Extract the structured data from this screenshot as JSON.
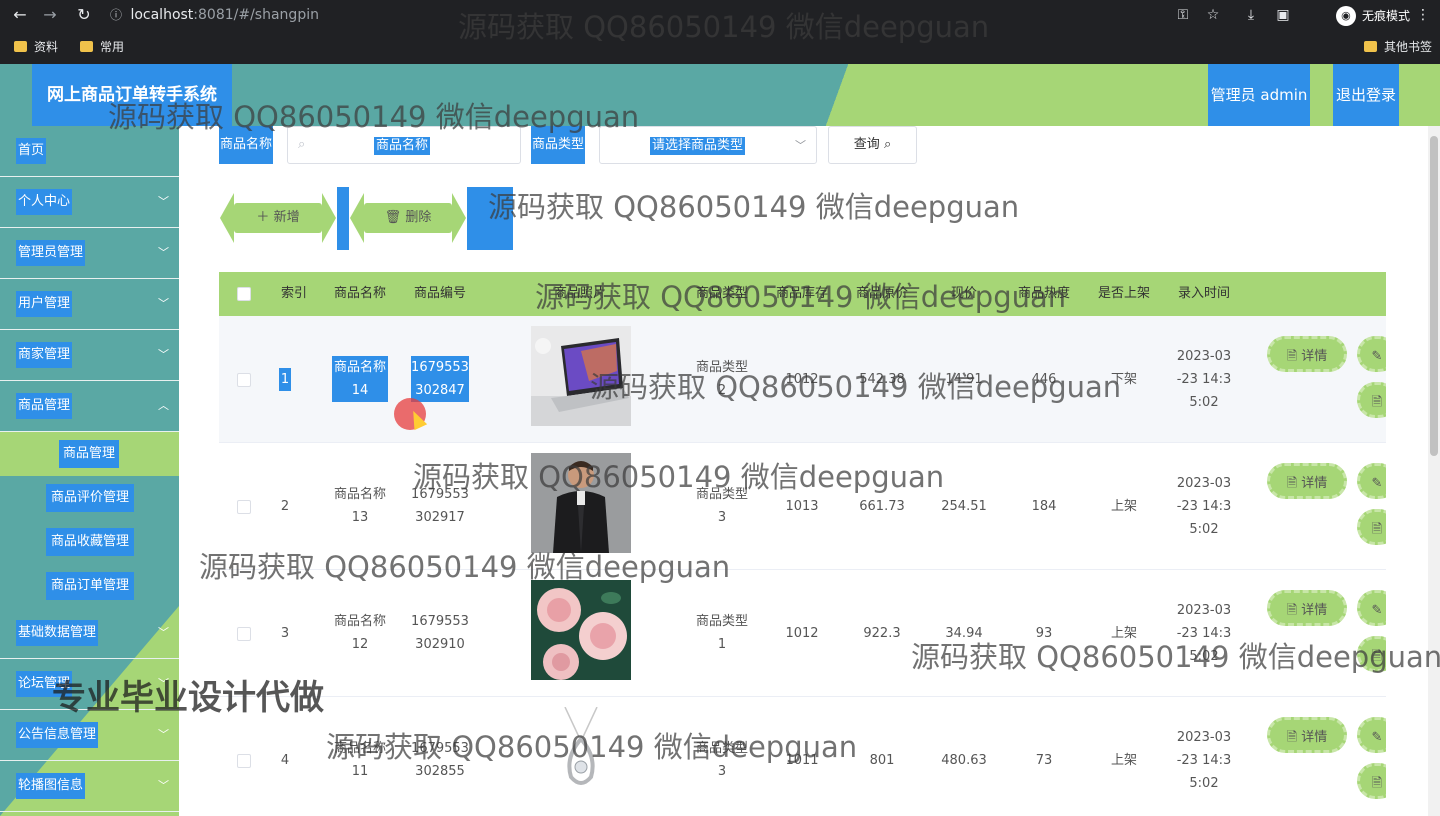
{
  "browser": {
    "url_host": "localhost",
    "url_path": ":8081/#/shangpin",
    "incognito_label": "无痕模式",
    "bookmarks": [
      "资料",
      "常用"
    ],
    "other_bookmarks": "其他书签"
  },
  "header": {
    "title": "网上商品订单转手系统",
    "admin": "管理员 admin",
    "logout": "退出登录"
  },
  "sidebar": {
    "items": [
      {
        "label": "首页"
      },
      {
        "label": "个人中心"
      },
      {
        "label": "管理员管理"
      },
      {
        "label": "用户管理"
      },
      {
        "label": "商家管理"
      },
      {
        "label": "商品管理"
      }
    ],
    "sub_items": [
      {
        "label": "商品管理"
      },
      {
        "label": "商品评价管理"
      },
      {
        "label": "商品收藏管理"
      },
      {
        "label": "商品订单管理"
      }
    ],
    "items_after": [
      {
        "label": "基础数据管理"
      },
      {
        "label": "论坛管理"
      },
      {
        "label": "公告信息管理"
      },
      {
        "label": "轮播图信息"
      }
    ]
  },
  "search": {
    "name_label": "商品名称",
    "name_placeholder": "商品名称",
    "type_label": "商品类型",
    "type_placeholder": "请选择商品类型",
    "query_button": "查询"
  },
  "actions": {
    "add": "新增",
    "delete": "删除"
  },
  "table": {
    "headers": [
      "索引",
      "商品名称",
      "商品编号",
      "商品照片",
      "商品类型",
      "商品库存",
      "商品原价",
      "现价",
      "商品热度",
      "是否上架",
      "录入时间",
      "操作"
    ],
    "detail_button": "详情",
    "rows": [
      {
        "index": "1",
        "name": [
          "商品名称",
          "14"
        ],
        "code": [
          "1679553",
          "302847"
        ],
        "type": [
          "商品类型",
          "2"
        ],
        "stock": "1012",
        "orig_price": "542.38",
        "price": "14.91",
        "heat": "446",
        "on_shelf": "下架",
        "time": [
          "2023-03",
          "-23 14:3",
          "5:02"
        ]
      },
      {
        "index": "2",
        "name": [
          "商品名称",
          "13"
        ],
        "code": [
          "1679553",
          "302917"
        ],
        "type": [
          "商品类型",
          "3"
        ],
        "stock": "1013",
        "orig_price": "661.73",
        "price": "254.51",
        "heat": "184",
        "on_shelf": "上架",
        "time": [
          "2023-03",
          "-23 14:3",
          "5:02"
        ]
      },
      {
        "index": "3",
        "name": [
          "商品名称",
          "12"
        ],
        "code": [
          "1679553",
          "302910"
        ],
        "type": [
          "商品类型",
          "1"
        ],
        "stock": "1012",
        "orig_price": "922.3",
        "price": "34.94",
        "heat": "93",
        "on_shelf": "上架",
        "time": [
          "2023-03",
          "-23 14:3",
          "5:02"
        ]
      },
      {
        "index": "4",
        "name": [
          "商品名称",
          "11"
        ],
        "code": [
          "1679553",
          "302855"
        ],
        "type": [
          "商品类型",
          "3"
        ],
        "stock": "1011",
        "orig_price": "801",
        "price": "480.63",
        "heat": "73",
        "on_shelf": "上架",
        "time": [
          "2023-03",
          "-23 14:3",
          "5:02"
        ]
      }
    ]
  },
  "watermarks": {
    "text": "源码获取 QQ86050149 微信deepguan",
    "banner": "专业毕业设计代做"
  },
  "colors": {
    "teal": "#5aa8a4",
    "green": "#a6d676",
    "blue": "#2f8fe8"
  }
}
